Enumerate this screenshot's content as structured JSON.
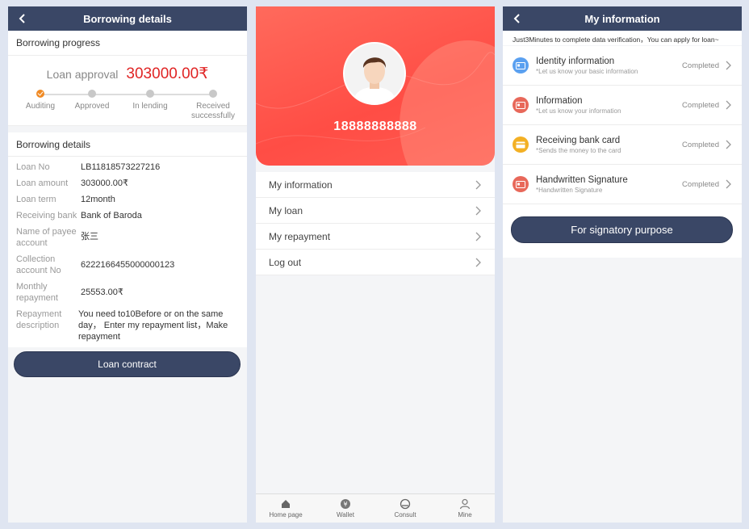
{
  "panel1": {
    "nav_title": "Borrowing details",
    "progress_title": "Borrowing progress",
    "approval_label": "Loan approval",
    "approval_amount": "303000.00₹",
    "steps": [
      {
        "label": "Auditing",
        "active": true
      },
      {
        "label": "Approved",
        "active": false
      },
      {
        "label": "In lending",
        "active": false
      },
      {
        "label": "Received successfully",
        "active": false
      }
    ],
    "details_title": "Borrowing details",
    "details": [
      {
        "key": "Loan No",
        "value": "LB11818573227216"
      },
      {
        "key": "Loan amount",
        "value": "303000.00₹"
      },
      {
        "key": "Loan term",
        "value": "12month"
      },
      {
        "key": "Receiving bank",
        "value": "Bank of Baroda"
      },
      {
        "key": "Name of payee account",
        "value": "张三"
      },
      {
        "key": "Collection account No",
        "value": "6222166455000000123"
      },
      {
        "key": "Monthly repayment",
        "value": "25553.00₹"
      },
      {
        "key": "Repayment description",
        "value": "You need to10Before or on the same day， Enter my repayment list，Make repayment"
      }
    ],
    "contract_button": "Loan contract"
  },
  "panel2": {
    "phone": "18888888888",
    "menu": [
      "My information",
      "My loan",
      "My repayment",
      "Log out"
    ],
    "tabs": [
      {
        "label": "Home page",
        "icon": "home-icon"
      },
      {
        "label": "Wallet",
        "icon": "wallet-icon"
      },
      {
        "label": "Consult",
        "icon": "consult-icon"
      },
      {
        "label": "Mine",
        "icon": "user-icon"
      }
    ]
  },
  "panel3": {
    "nav_title": "My information",
    "notice": "Just3Minutes to complete data verification，You can apply for loan~",
    "items": [
      {
        "title": "Identity information",
        "sub": "*Let us know your basic information",
        "status": "Completed",
        "color": "#5aa0f0",
        "icon": "id-card-icon"
      },
      {
        "title": "Information",
        "sub": "*Let us know your information",
        "status": "Completed",
        "color": "#e8685a",
        "icon": "info-card-icon"
      },
      {
        "title": "Receiving bank card",
        "sub": "*Sends the money to the card",
        "status": "Completed",
        "color": "#f3b024",
        "icon": "bank-card-icon"
      },
      {
        "title": "Handwritten Signature",
        "sub": "*Handwritten Signature",
        "status": "Completed",
        "color": "#e8685a",
        "icon": "signature-icon"
      }
    ],
    "sign_button": "For signatory purpose"
  },
  "colors": {
    "nav": "#3a4766",
    "accent_red": "#e02424",
    "hero_red": "#ff4d45",
    "step_active": "#f08a24"
  }
}
